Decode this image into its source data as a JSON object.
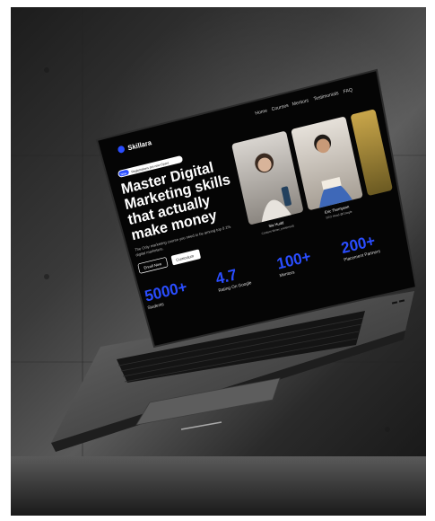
{
  "brand": {
    "name": "Skillara",
    "accent": "#2a4dff"
  },
  "nav": [
    "Home",
    "Courses",
    "Mentors",
    "Testimonials",
    "FAQ"
  ],
  "hero": {
    "badge_tag": "New",
    "badge_text": "Registrations are now Open!",
    "headline": [
      "Master Digital",
      "Marketing skills",
      "that actually",
      "make money"
    ],
    "subtext": [
      "The Only marketing course you need to be among top 0.1%",
      "digital marketers."
    ],
    "cta_primary": "Enroll Now",
    "cta_secondary": "Curriculum"
  },
  "mentors": [
    {
      "name": "Sia Hudd",
      "role": "Content Writer, preferredS"
    },
    {
      "name": "Eric Thompson",
      "role": "SEO Head @Google"
    }
  ],
  "stats": [
    {
      "value": "5000+",
      "label": "Students"
    },
    {
      "value": "4.7",
      "label": "Rating On Google"
    },
    {
      "value": "100+",
      "label": "Mentors"
    },
    {
      "value": "200+",
      "label": "Placement Partners"
    }
  ]
}
